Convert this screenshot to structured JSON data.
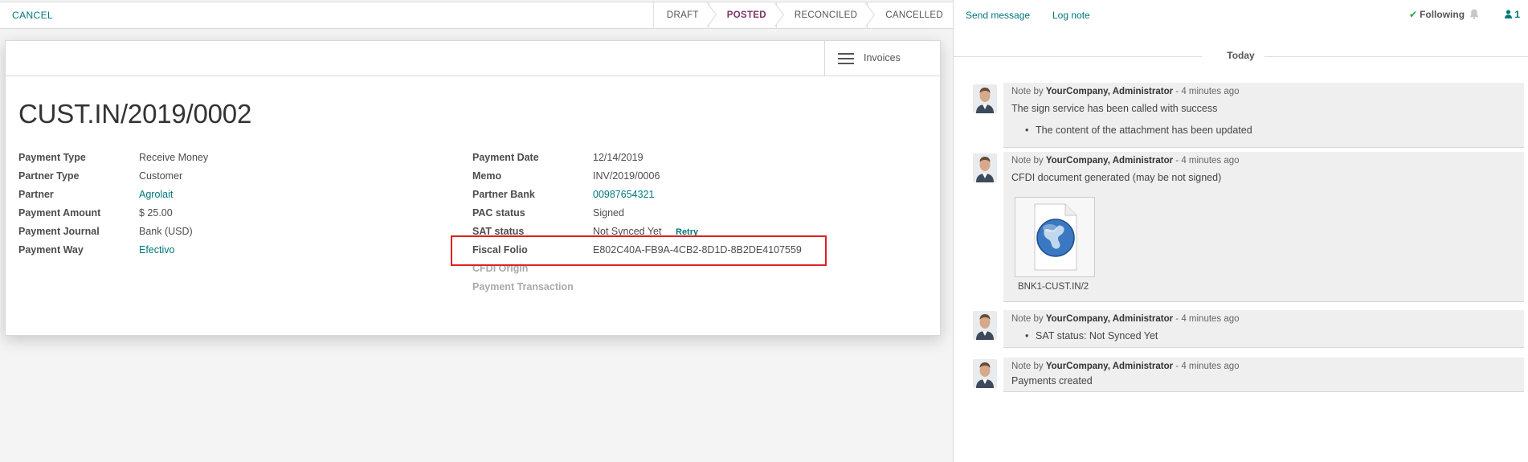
{
  "statusbar": {
    "cancel_label": "CANCEL",
    "stages": [
      "DRAFT",
      "POSTED",
      "RECONCILED",
      "CANCELLED"
    ],
    "active_stage": "POSTED"
  },
  "smart_button": {
    "label": "Invoices",
    "icon": "hamburger-icon"
  },
  "record": {
    "title": "CUST.IN/2019/0002",
    "left_fields": [
      {
        "label": "Payment Type",
        "value": "Receive Money"
      },
      {
        "label": "Partner Type",
        "value": "Customer"
      },
      {
        "label": "Partner",
        "value": "Agrolait"
      },
      {
        "label": "Payment Amount",
        "value": "$ 25.00"
      },
      {
        "label": "Payment Journal",
        "value": "Bank (USD)"
      },
      {
        "label": "Payment Way",
        "value": "Efectivo"
      }
    ],
    "right_fields": [
      {
        "label": "Payment Date",
        "value": "12/14/2019"
      },
      {
        "label": "Memo",
        "value": "INV/2019/0006"
      },
      {
        "label": "Partner Bank",
        "value": "00987654321"
      },
      {
        "label": "PAC status",
        "value": "Signed"
      },
      {
        "label": "SAT status",
        "value": "Not Synced Yet"
      },
      {
        "label": "Fiscal Folio",
        "value": "E802C40A-FB9A-4CB2-8D1D-8B2DE4107559"
      },
      {
        "label": "CFDI Origin",
        "value": ""
      },
      {
        "label": "Payment Transaction",
        "value": ""
      }
    ],
    "retry_label": "Retry"
  },
  "chatter": {
    "send_message": "Send message",
    "log_note": "Log note",
    "following": "Following",
    "followers_count": "1",
    "day_label": "Today",
    "messages": [
      {
        "prefix": "Note by",
        "author": "YourCompany, Administrator",
        "time": "- 4 minutes ago",
        "body": "The sign service has been called with success",
        "bullets": [
          "The content of the attachment has been updated"
        ]
      },
      {
        "prefix": "Note by",
        "author": "YourCompany, Administrator",
        "time": "- 4 minutes ago",
        "body": "CFDI document generated (may be not signed)",
        "attachment": "BNK1-CUST.IN/2"
      },
      {
        "prefix": "Note by",
        "author": "YourCompany, Administrator",
        "time": "- 4 minutes ago",
        "bullets": [
          "SAT status: Not Synced Yet"
        ]
      },
      {
        "prefix": "Note by",
        "author": "YourCompany, Administrator",
        "time": "- 4 minutes ago",
        "body": "Payments created"
      }
    ]
  },
  "colors": {
    "link": "#00777b",
    "active_stage": "#7c3565",
    "highlight_box": "#e02020"
  }
}
